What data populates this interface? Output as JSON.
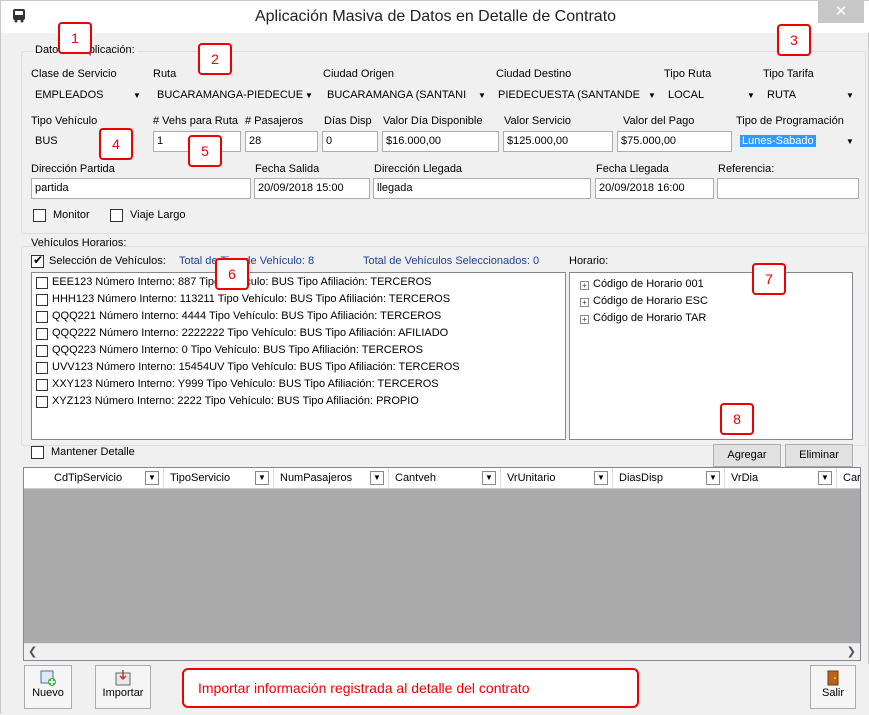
{
  "window": {
    "title": "Aplicación Masiva de Datos en Detalle de Contrato",
    "close_glyph": "✕"
  },
  "datos_aplicacion": {
    "group_label": "Datos de Aplicación:",
    "labels": {
      "clase_servicio": "Clase de Servicio",
      "ruta": "Ruta",
      "ciudad_origen": "Ciudad Origen",
      "ciudad_destino": "Ciudad Destino",
      "tipo_ruta": "Tipo Ruta",
      "tipo_tarifa": "Tipo Tarifa",
      "tipo_vehiculo": "Tipo Vehículo",
      "vehs_ruta": "# Vehs para Ruta",
      "pasajeros": "# Pasajeros",
      "dias_disp": "Días Disp",
      "valor_dia": "Valor Día Disponible",
      "valor_servicio": "Valor Servicio",
      "valor_pago": "Valor del Pago",
      "tipo_programacion": "Tipo de Programación",
      "direccion_partida": "Dirección Partida",
      "fecha_salida": "Fecha Salida",
      "direccion_llegada": "Dirección Llegada",
      "fecha_llegada": "Fecha Llegada",
      "referencia": "Referencia:"
    },
    "values": {
      "clase_servicio": "EMPLEADOS",
      "ruta": "BUCARAMANGA-PIEDECUE",
      "ciudad_origen": "BUCARAMANGA (SANTANI",
      "ciudad_destino": "PIEDECUESTA (SANTANDE",
      "tipo_ruta": "LOCAL",
      "tipo_tarifa": "RUTA",
      "tipo_vehiculo": "BUS",
      "vehs_ruta": "1",
      "pasajeros": "28",
      "dias_disp": "0",
      "valor_dia": "$16.000,00",
      "valor_servicio": "$125.000,00",
      "valor_pago": "$75.000,00",
      "tipo_programacion": "Lunes-Sabado",
      "direccion_partida": "partida",
      "fecha_salida": "20/09/2018 15:00",
      "direccion_llegada": "llegada",
      "fecha_llegada": "20/09/2018 16:00",
      "referencia": ""
    },
    "checks": {
      "monitor": "Monitor",
      "viaje_largo": "Viaje Largo"
    }
  },
  "vehiculos": {
    "group_label": "Vehículos Horarios:",
    "seleccion_label": "Selección de Vehículos:",
    "total_tipo": "Total de Tipo de Vehículo: 8",
    "total_seleccionados": "Total de Vehículos Seleccionados: 0",
    "items": [
      "EEE123 Número Interno: 887 Tipo Vehículo: BUS Tipo Afiliación: TERCEROS",
      "HHH123 Número Interno: 113211 Tipo Vehículo: BUS Tipo Afiliación: TERCEROS",
      "QQQ221 Número Interno: 4444 Tipo Vehículo: BUS Tipo Afiliación: TERCEROS",
      "QQQ222 Número Interno: 2222222 Tipo Vehículo: BUS Tipo Afiliación: AFILIADO",
      "QQQ223 Número Interno: 0 Tipo Vehículo: BUS Tipo Afiliación: TERCEROS",
      "UVV123 Número Interno: 15454UV Tipo Vehículo: BUS Tipo Afiliación: TERCEROS",
      "XXY123 Número Interno: Y999 Tipo Vehículo: BUS Tipo Afiliación: TERCEROS",
      "XYZ123 Número Interno: 2222 Tipo Vehículo: BUS Tipo Afiliación: PROPIO"
    ]
  },
  "horario": {
    "label": "Horario:",
    "items": [
      "Código de Horario 001",
      "Código de Horario ESC",
      "Código de Horario TAR"
    ]
  },
  "detalle": {
    "mantener_label": "Mantener Detalle",
    "agregar": "Agregar",
    "eliminar": "Eliminar",
    "columns": [
      "CdTipServicio",
      "TipoServicio",
      "NumPasajeros",
      "Cantveh",
      "VrUnitario",
      "DiasDisp",
      "VrDia",
      "Car"
    ]
  },
  "toolbar": {
    "nuevo": "Nuevo",
    "importar": "Importar",
    "salir": "Salir",
    "info": "Importar información registrada al detalle del contrato"
  },
  "callouts": [
    "1",
    "2",
    "3",
    "4",
    "5",
    "6",
    "7",
    "8"
  ],
  "colors": {
    "callout": "#e00000",
    "link_blue": "#1f3f9a",
    "selection": "#3399ff"
  }
}
